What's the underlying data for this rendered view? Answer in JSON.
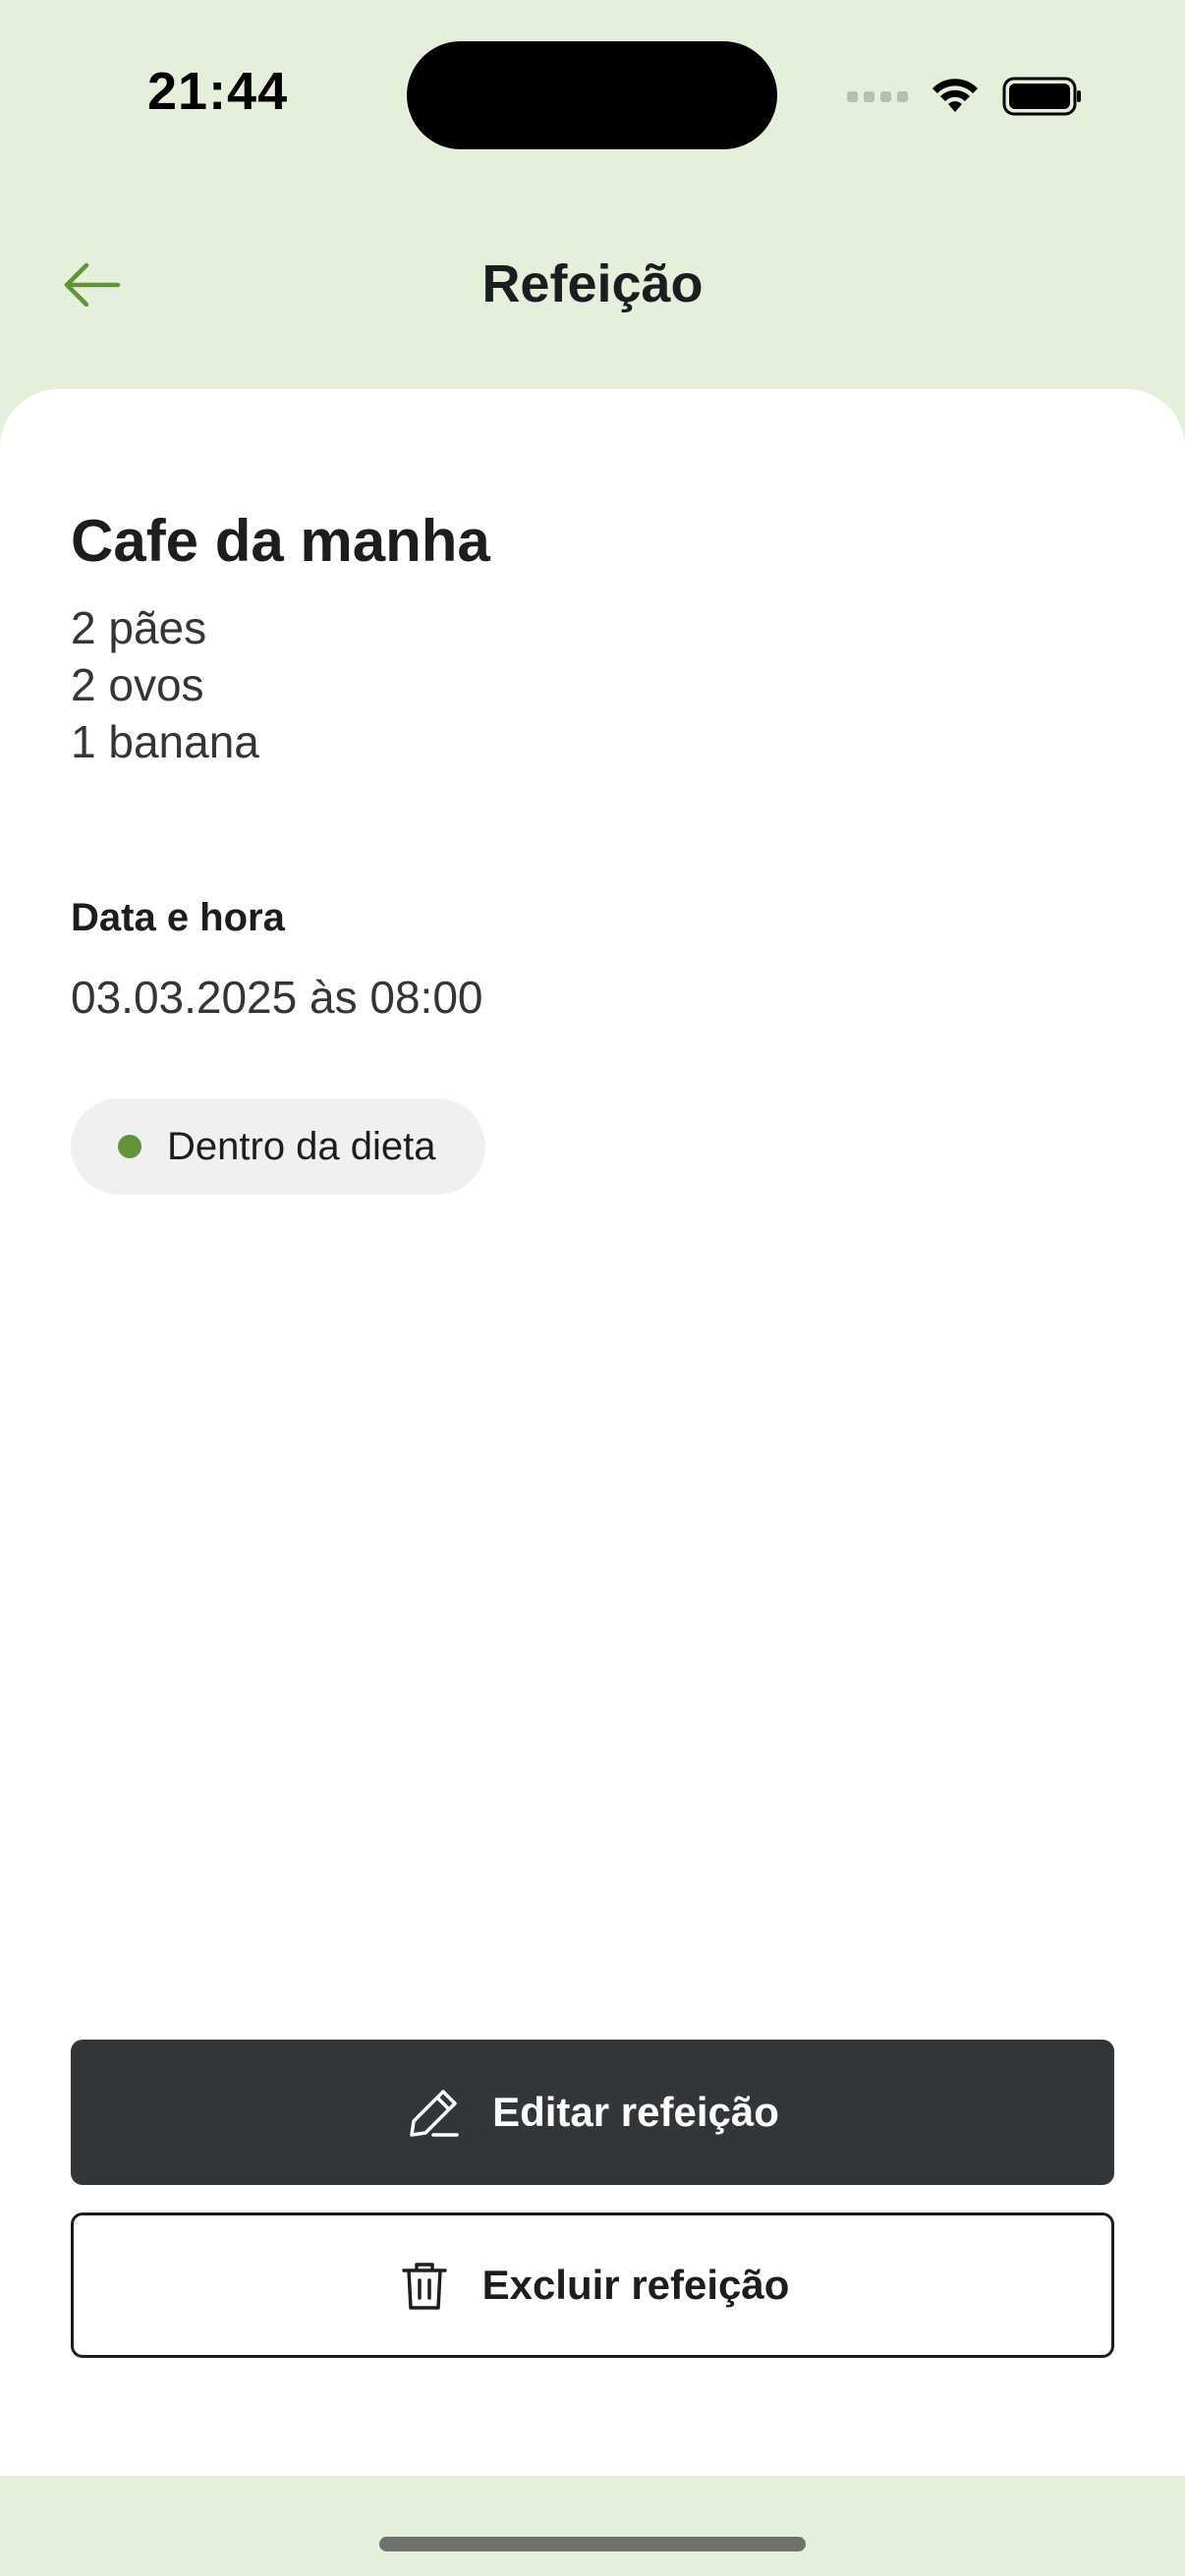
{
  "status_bar": {
    "time": "21:44"
  },
  "header": {
    "title": "Refeição",
    "back_icon": "arrow-left-icon"
  },
  "meal": {
    "name": "Cafe da manha",
    "description_lines": [
      "2 pães",
      "2 ovos",
      "1 banana"
    ],
    "datetime_label": "Data e hora",
    "datetime_value": "03.03.2025 às 08:00",
    "diet_status": "Dentro da dieta",
    "diet_status_color": "#639339"
  },
  "actions": {
    "edit_label": "Editar refeição",
    "edit_icon": "pencil-icon",
    "delete_label": "Excluir refeição",
    "delete_icon": "trash-icon"
  },
  "colors": {
    "background": "#E5F0DB",
    "accent": "#639339",
    "primary_button": "#333638",
    "card": "#FFFFFF"
  }
}
